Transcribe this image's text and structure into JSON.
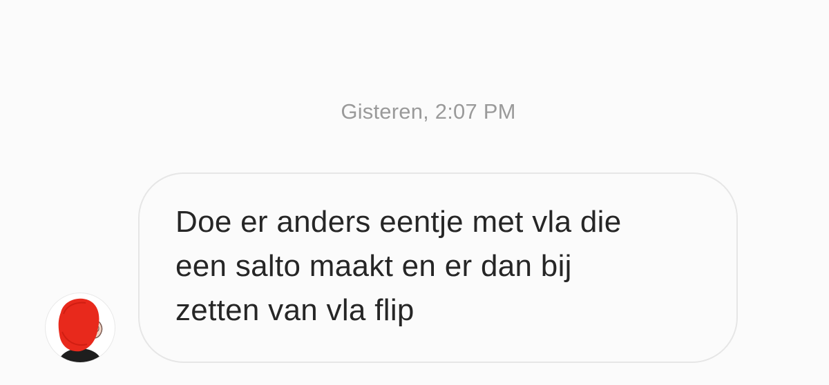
{
  "conversation": {
    "timestamp": "Gisteren, 2:07 PM",
    "message": {
      "lines": [
        "Doe er anders eentje met vla die",
        "een salto maakt en er dan bij",
        "zetten van vla flip"
      ]
    },
    "sender": {
      "avatar_icon": "profile-avatar-icon"
    }
  },
  "colors": {
    "background": "#fbfbfb",
    "bubble_border": "#e6e6e6",
    "timestamp_text": "#9a9a9a",
    "message_text": "#262626",
    "avatar_redaction": "#e8291c"
  }
}
